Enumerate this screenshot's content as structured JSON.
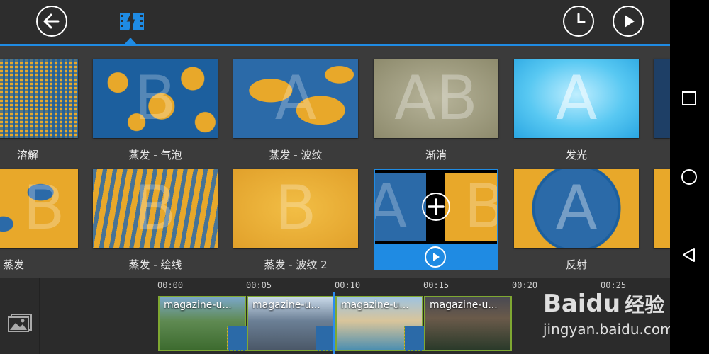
{
  "transitions": [
    {
      "label": "溶解"
    },
    {
      "label": "蒸发 - 气泡"
    },
    {
      "label": "蒸发 - 波纹"
    },
    {
      "label": "渐消"
    },
    {
      "label": "发光"
    },
    {
      "label": "蒸发"
    },
    {
      "label": "蒸发 - 绘线"
    },
    {
      "label": "蒸发 - 波纹 2"
    },
    {
      "label": ""
    },
    {
      "label": "反射"
    }
  ],
  "thumb_letters": {
    "t1": "B",
    "t2": "A",
    "t3": "AB",
    "t4": "A",
    "t5": "B",
    "t6": "B",
    "t7": "B",
    "t8a": "A",
    "t8b": "B",
    "t9": "A"
  },
  "timeline": {
    "times": [
      "00:00",
      "00:05",
      "00:10",
      "00:15",
      "00:20",
      "00:25"
    ],
    "clips": [
      {
        "title": "magazine-u..."
      },
      {
        "title": "magazine-u..."
      },
      {
        "title": "magazine-u..."
      },
      {
        "title": "magazine-u..."
      }
    ]
  },
  "watermark": {
    "brand": "Baidu",
    "brand_cn": "经验",
    "url": "jingyan.baidu.com"
  },
  "icons": {
    "back": "back-arrow-icon",
    "transition_tab": "film-transition-icon",
    "clock": "clock-icon",
    "play": "play-icon",
    "add": "plus-icon",
    "media": "media-library-icon"
  },
  "colors": {
    "accent": "#1f8be3",
    "clip_border": "#7fa832",
    "gold": "#e8a82a",
    "blue": "#1c5f9e"
  }
}
